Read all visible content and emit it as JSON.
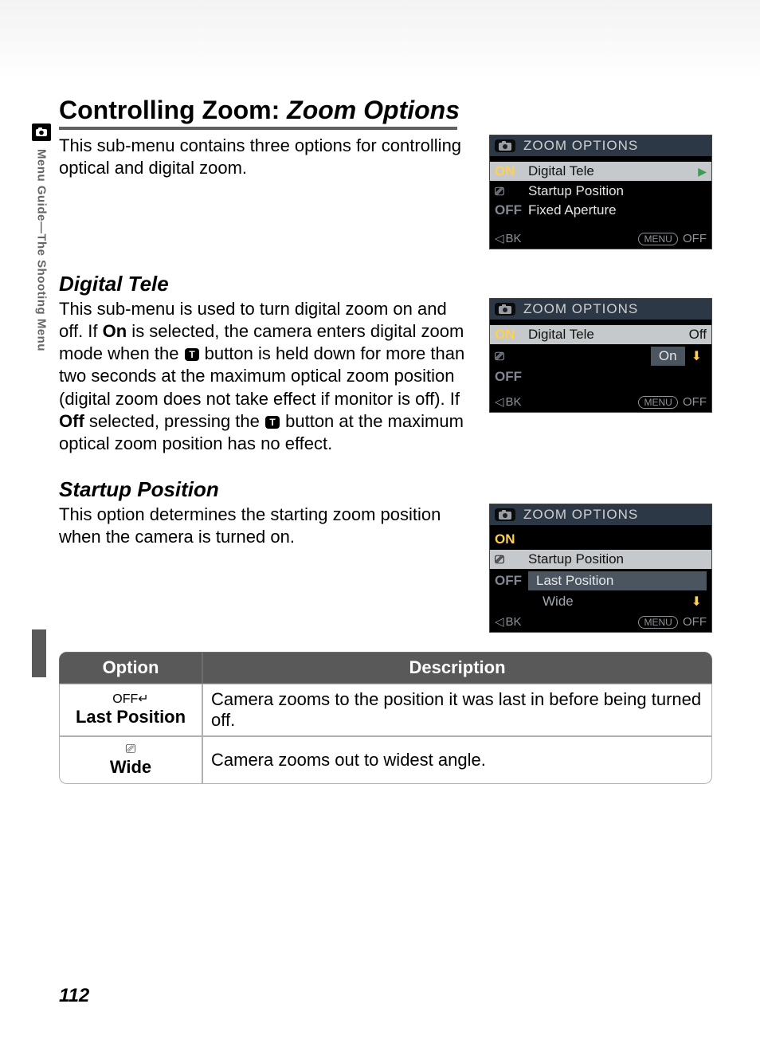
{
  "side_tab_text": "Menu Guide—The Shooting Menu",
  "h1_plain": "Controlling Zoom: ",
  "h1_ital": "Zoom Options",
  "intro": "This sub-menu contains three options for controlling optical and digital zoom.",
  "section_digital_tele_title": "Digital Tele",
  "digital_tele_body_1": "This sub-menu is used to turn digital zoom on and off.  If ",
  "digital_tele_body_on": "On",
  "digital_tele_body_2": " is selected, the camera enters digital zoom mode when the ",
  "digital_tele_body_3": " button is held down for more than two seconds at the maximum optical zoom position (digital zoom does not take effect if monitor is off).  If ",
  "digital_tele_body_off": "Off",
  "digital_tele_body_4": " selected, pressing the ",
  "digital_tele_body_5": " button at the maximum optical zoom position has no effect.",
  "section_startup_title": "Startup Position",
  "startup_body": "This option determines the starting zoom position when the camera is turned on.",
  "lcd_title": "ZOOM OPTIONS",
  "lcd1": {
    "line1_badge": "ON",
    "line1_text": "Digital Tele",
    "line2_text": "Startup Position",
    "line3_badge": "OFF",
    "line3_text": "Fixed Aperture"
  },
  "lcd2": {
    "on_badge": "ON",
    "line_text": "Digital Tele",
    "opt_off": "Off",
    "opt_on": "On",
    "off_badge": "OFF"
  },
  "lcd3": {
    "on_badge": "ON",
    "line_text": "Startup Position",
    "opt_last": "Last Position",
    "opt_wide": "Wide",
    "off_badge": "OFF"
  },
  "lcd_bk": "BK",
  "lcd_menu": "MENU",
  "lcd_off": "OFF",
  "table": {
    "header_option": "Option",
    "header_desc": "Description",
    "rows": [
      {
        "icon": "OFF↵",
        "label": "Last Position",
        "desc": "Camera zooms to the position it was last in before being turned off."
      },
      {
        "icon": "⎚",
        "label": "Wide",
        "desc": "Camera zooms out to widest angle."
      }
    ]
  },
  "page_number": "112"
}
